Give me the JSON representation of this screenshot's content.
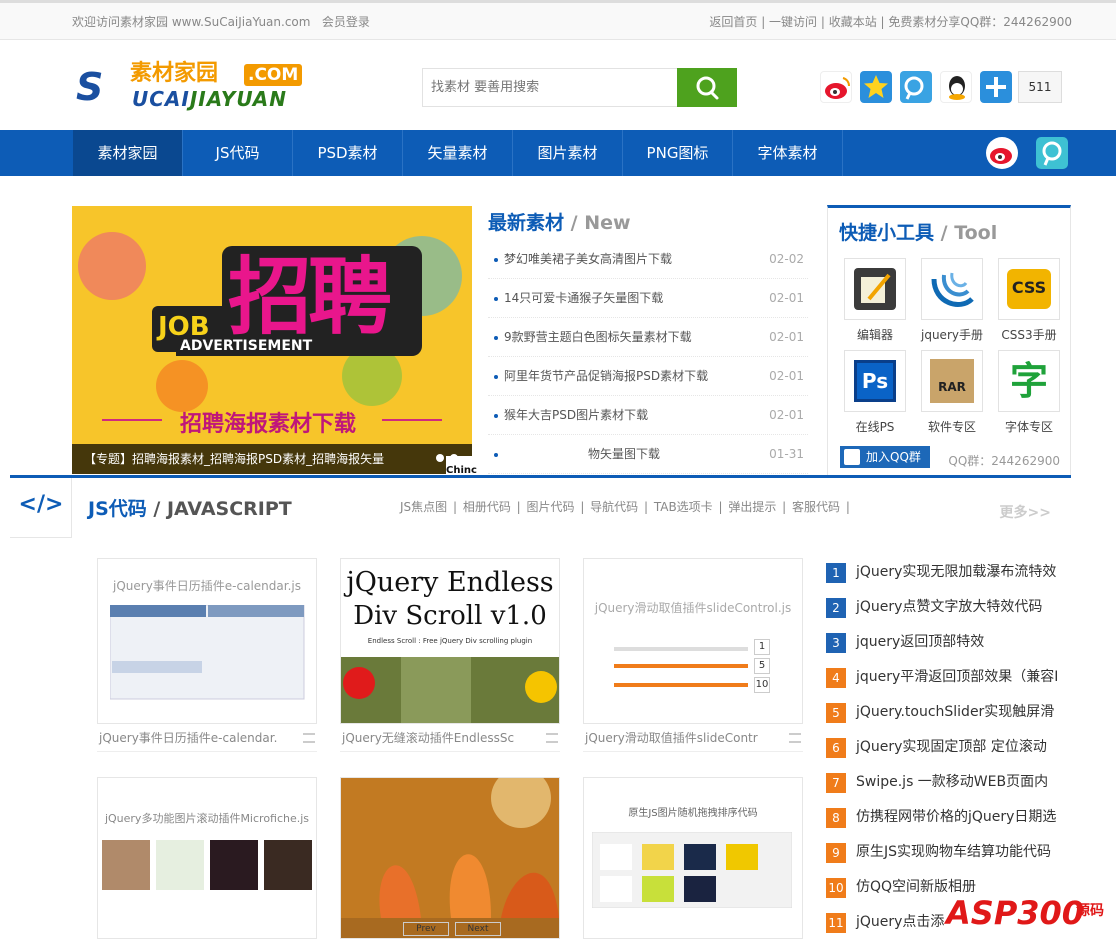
{
  "topbar": {
    "welcome": "欢迎访问素材家园 www.SuCaiJiaYuan.com",
    "login": "会员登录",
    "right": "返回首页 | 一键访问 | 收藏本站 | 免费素材分享QQ群：244262900"
  },
  "logo": {
    "cn": "素材家园",
    "com": ".COM",
    "s": "S",
    "en1": "UCAI",
    "en2": "JIAYUAN"
  },
  "search": {
    "placeholder": "找素材 要善用搜索"
  },
  "share": {
    "count": "511",
    "icons": [
      "weibo-icon",
      "star-icon",
      "qzone-icon",
      "qq-icon",
      "plus-icon"
    ]
  },
  "nav": {
    "items": [
      "素材家园",
      "JS代码",
      "PSD素材",
      "矢量素材",
      "图片素材",
      "PNG图标",
      "字体素材"
    ]
  },
  "banner": {
    "caption": "【专题】招聘海报素材_招聘海报PSD素材_招聘海报矢量",
    "big": "招聘",
    "job": "JOB",
    "adv": "ADVERTISEMENT",
    "sub": "招聘海报素材下载",
    "overlay": "Chinc"
  },
  "newest": {
    "title": "最新素材",
    "title_en": "/ New",
    "items": [
      {
        "t": "梦幻唯美裙子美女高清图片下载",
        "d": "02-02"
      },
      {
        "t": "14只可爱卡通猴子矢量图下载",
        "d": "02-01"
      },
      {
        "t": "9款野营主题白色图标矢量素材下载",
        "d": "02-01"
      },
      {
        "t": "阿里年货节产品促销海报PSD素材下载",
        "d": "02-01"
      },
      {
        "t": "猴年大吉PSD图片素材下载",
        "d": "02-01"
      },
      {
        "t": "物矢量图下载",
        "d": "01-31"
      }
    ]
  },
  "tools": {
    "title": "快捷小工具",
    "title_en": "/ Tool",
    "items": [
      "编辑器",
      "jquery手册",
      "CSS3手册",
      "在线PS",
      "软件专区",
      "字体专区"
    ],
    "icon_text": [
      "",
      "",
      "CSS",
      "Ps",
      "RAR",
      "字"
    ],
    "qq": "加入QQ群",
    "qqnum": "QQ群：244262900"
  },
  "js": {
    "title": "JS代码",
    "title_en": "/ JAVASCRIPT",
    "links": "JS焦点图 | 相册代码 | 图片代码 | 导航代码 | TAB选项卡 | 弹出提示 | 客服代码 |",
    "more": "更多>>",
    "code": "</>"
  },
  "cards": [
    {
      "cap": "jQuery事件日历插件e-calendar.",
      "pic": "jQuery事件日历插件e-calendar.js"
    },
    {
      "cap": "jQuery无缝滚动插件EndlessSc",
      "pic": "jQuery Endless",
      "pic2": "Div Scroll v1.0",
      "pic3": "Endless Scroll : Free jQuery Div scrolling plugin"
    },
    {
      "cap": "jQuery滑动取值插件slideContr",
      "pic": "jQuery滑动取值插件slideControl.js"
    },
    {
      "cap": "",
      "pic": "jQuery多功能图片滚动插件Microfiche.js"
    },
    {
      "cap": "",
      "pic": "",
      "prev": "Prev",
      "next": "Next"
    },
    {
      "cap": "",
      "pic": "原生JS图片随机拖拽排序代码"
    }
  ],
  "slider": {
    "v1": "1",
    "v2": "5",
    "v3": "10"
  },
  "rank": [
    {
      "n": "1",
      "t": "jQuery实现无限加载瀑布流特效"
    },
    {
      "n": "2",
      "t": "jQuery点赞文字放大特效代码"
    },
    {
      "n": "3",
      "t": "jquery返回顶部特效"
    },
    {
      "n": "4",
      "t": "jquery平滑返回顶部效果（兼容I"
    },
    {
      "n": "5",
      "t": "jQuery.touchSlider实现触屏滑"
    },
    {
      "n": "6",
      "t": "jQuery实现固定顶部 定位滚动"
    },
    {
      "n": "7",
      "t": "Swipe.js 一款移动WEB页面内"
    },
    {
      "n": "8",
      "t": "仿携程网带价格的jQuery日期选"
    },
    {
      "n": "9",
      "t": "原生JS实现购物车结算功能代码"
    },
    {
      "n": "10",
      "t": "仿QQ空间新版相册"
    },
    {
      "n": "11",
      "t": "jQuery点击添"
    }
  ],
  "watermark": {
    "brand": "ASP300",
    "tag": "源码"
  },
  "colors": {
    "brand": "#0d5cb6",
    "search": "#4ea21e",
    "orange": "#f07c1a"
  }
}
